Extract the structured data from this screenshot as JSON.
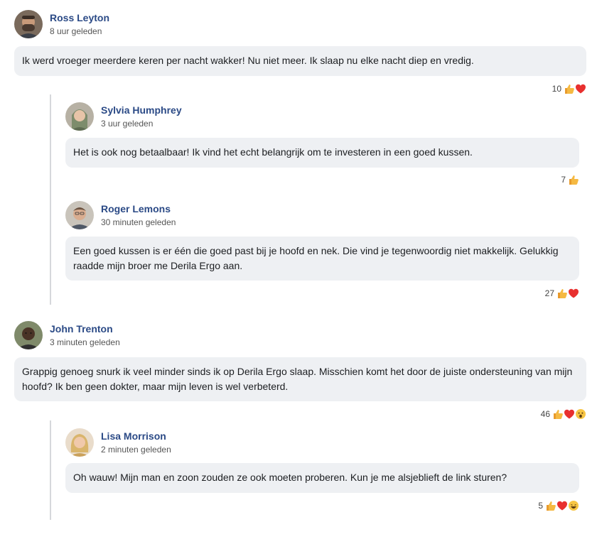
{
  "comments": [
    {
      "name": "Ross Leyton",
      "time": "8 uur geleden",
      "text": "Ik werd vroeger meerdere keren per nacht wakker! Nu niet meer. Ik slaap nu elke nacht diep en vredig.",
      "reaction_count": "10",
      "reactions": [
        "thumbs-up-icon",
        "heart-icon"
      ]
    },
    {
      "name": "Sylvia Humphrey",
      "time": "3 uur geleden",
      "text": "Het is ook nog betaalbaar! Ik vind het echt belangrijk om te investeren in een goed kussen.",
      "reaction_count": "7",
      "reactions": [
        "thumbs-up-icon"
      ]
    },
    {
      "name": "Roger Lemons",
      "time": "30 minuten geleden",
      "text": "Een goed kussen is er één die goed past bij je hoofd en nek. Die vind je tegenwoordig niet makkelijk. Gelukkig raadde mijn broer me Derila Ergo aan.",
      "reaction_count": "27",
      "reactions": [
        "thumbs-up-icon",
        "heart-icon"
      ]
    },
    {
      "name": "John Trenton",
      "time": "3 minuten geleden",
      "text": "Grappig genoeg snurk ik veel minder sinds ik op Derila Ergo slaap. Misschien komt het door de juiste ondersteuning van mijn hoofd? Ik ben geen dokter, maar mijn leven is wel verbeterd.",
      "reaction_count": "46",
      "reactions": [
        "thumbs-up-icon",
        "heart-icon",
        "wow-icon"
      ]
    },
    {
      "name": "Lisa Morrison",
      "time": "2 minuten geleden",
      "text": "Oh wauw! Mijn man en zoon zouden ze ook moeten proberen. Kun je me alsjeblieft de link sturen?",
      "reaction_count": "5",
      "reactions": [
        "thumbs-up-icon",
        "heart-icon",
        "haha-icon"
      ]
    }
  ],
  "colors": {
    "name": "#2b4a86",
    "bubble": "#eef0f3",
    "thread_line": "#d6d8db",
    "like": "#f2a93b",
    "heart": "#e8302f"
  }
}
